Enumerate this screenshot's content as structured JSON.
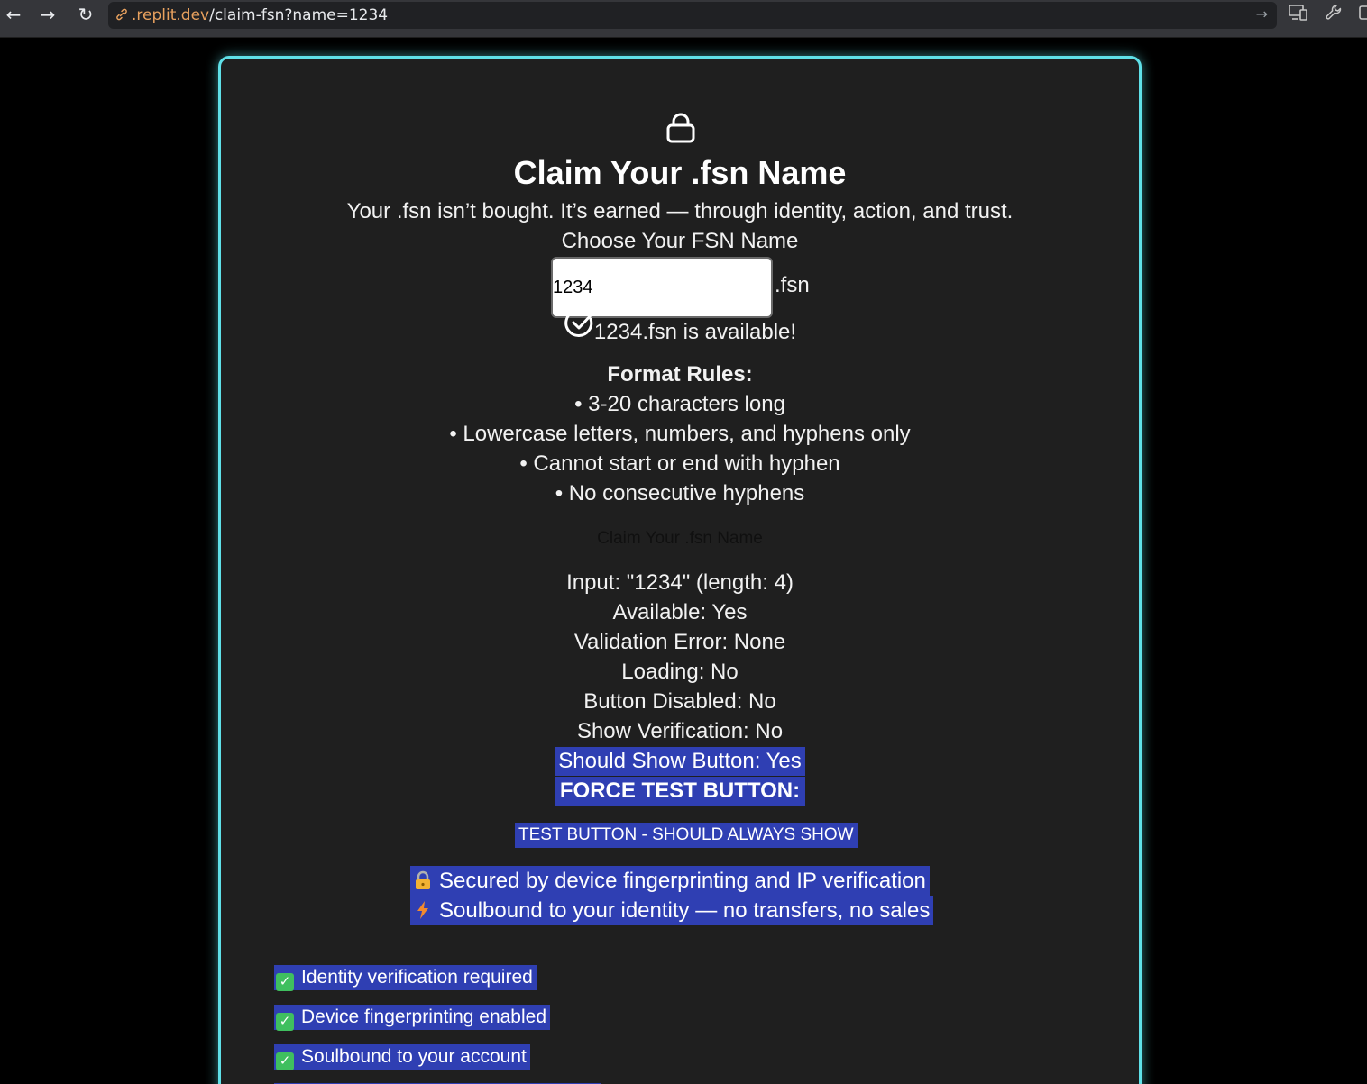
{
  "browser": {
    "url_host": ".replit.dev",
    "url_path": "/claim-fsn?name=1234",
    "back_icon": "←",
    "forward_icon": "→",
    "reload_icon": "↻"
  },
  "card": {
    "lock_icon": "lock-icon",
    "title": "Claim Your .fsn Name",
    "subtitle": "Your .fsn isn’t bought. It’s earned — through identity, action, and trust.",
    "choose_label": "Choose Your FSN Name",
    "name_value": "1234",
    "suffix": ".fsn",
    "availability": "1234.fsn is available!",
    "rules_title": "Format Rules:",
    "rules": [
      "• 3-20 characters long",
      "• Lowercase letters, numbers, and hyphens only",
      "• Cannot start or end with hyphen",
      "• No consecutive hyphens"
    ],
    "ghost_button": "Claim Your .fsn Name",
    "debug": [
      "Input: \"1234\" (length: 4)",
      "Available: Yes",
      "Validation Error: None",
      "Loading: No",
      "Button Disabled: No",
      "Show Verification: No"
    ],
    "should_show": "Should Show Button: Yes",
    "force_test": "FORCE TEST BUTTON:",
    "test_button": "TEST BUTTON - SHOULD ALWAYS SHOW",
    "security": [
      "Secured by device fingerprinting and IP verification",
      "Soulbound to your identity — no transfers, no sales"
    ],
    "features": [
      "Identity verification required",
      "Device fingerprinting enabled",
      "Soulbound to your account"
    ]
  },
  "colors": {
    "accent_border": "#5fe0e8",
    "highlight": "#2f3fb3",
    "card_bg": "#1f1f1f"
  }
}
